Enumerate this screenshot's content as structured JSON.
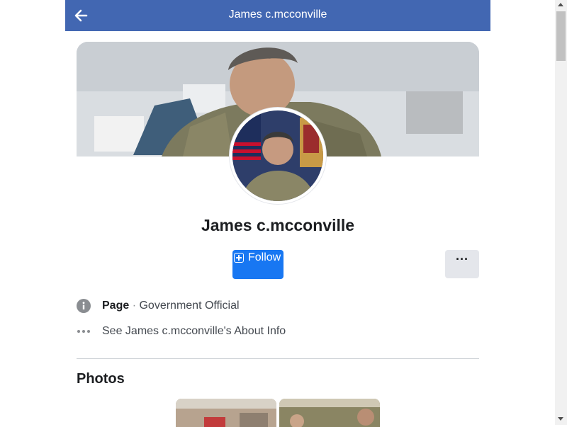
{
  "header": {
    "title": "James c.mcconville",
    "back_icon": "arrow-left-icon"
  },
  "profile": {
    "name": "James c.mcconville",
    "follow_label": "Follow",
    "more_label": "···"
  },
  "info": {
    "page_label": "Page",
    "separator": " · ",
    "category": "Government Official",
    "about_link": "See James c.mcconville's About Info"
  },
  "photos": {
    "title": "Photos"
  },
  "colors": {
    "topbar": "#4267b2",
    "follow": "#1877f2",
    "more_bg": "#e4e6eb"
  }
}
